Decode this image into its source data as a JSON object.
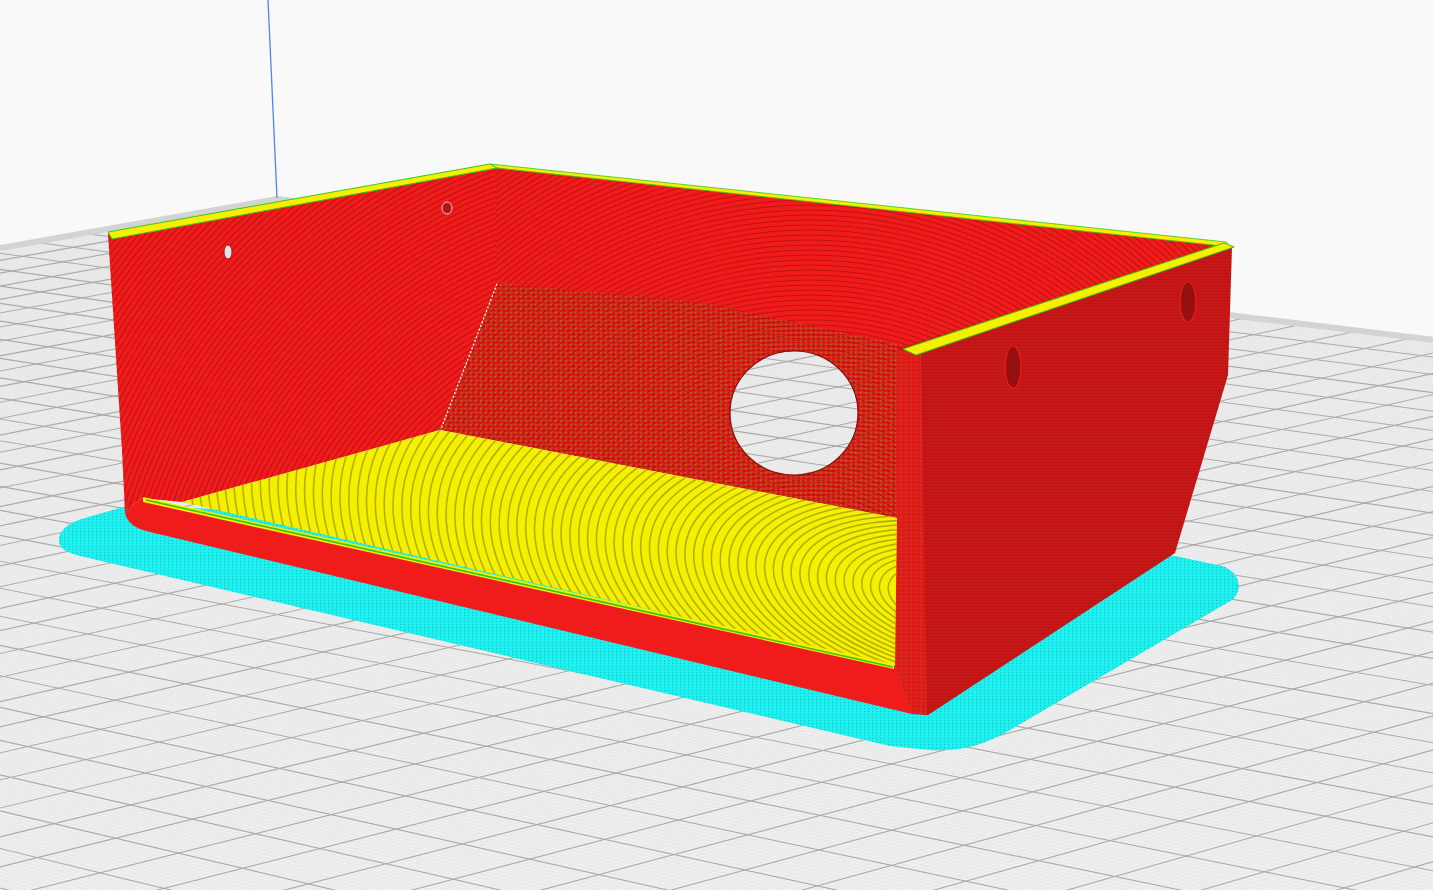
{
  "model": {
    "parts": [
      {
        "kind": "brim",
        "color": "#1ff0f0"
      },
      {
        "kind": "outer-wall",
        "color": "#f01c1c"
      },
      {
        "kind": "skin",
        "color": "#f5f000"
      },
      {
        "kind": "inner-wall",
        "color": "#38c41c"
      }
    ]
  }
}
